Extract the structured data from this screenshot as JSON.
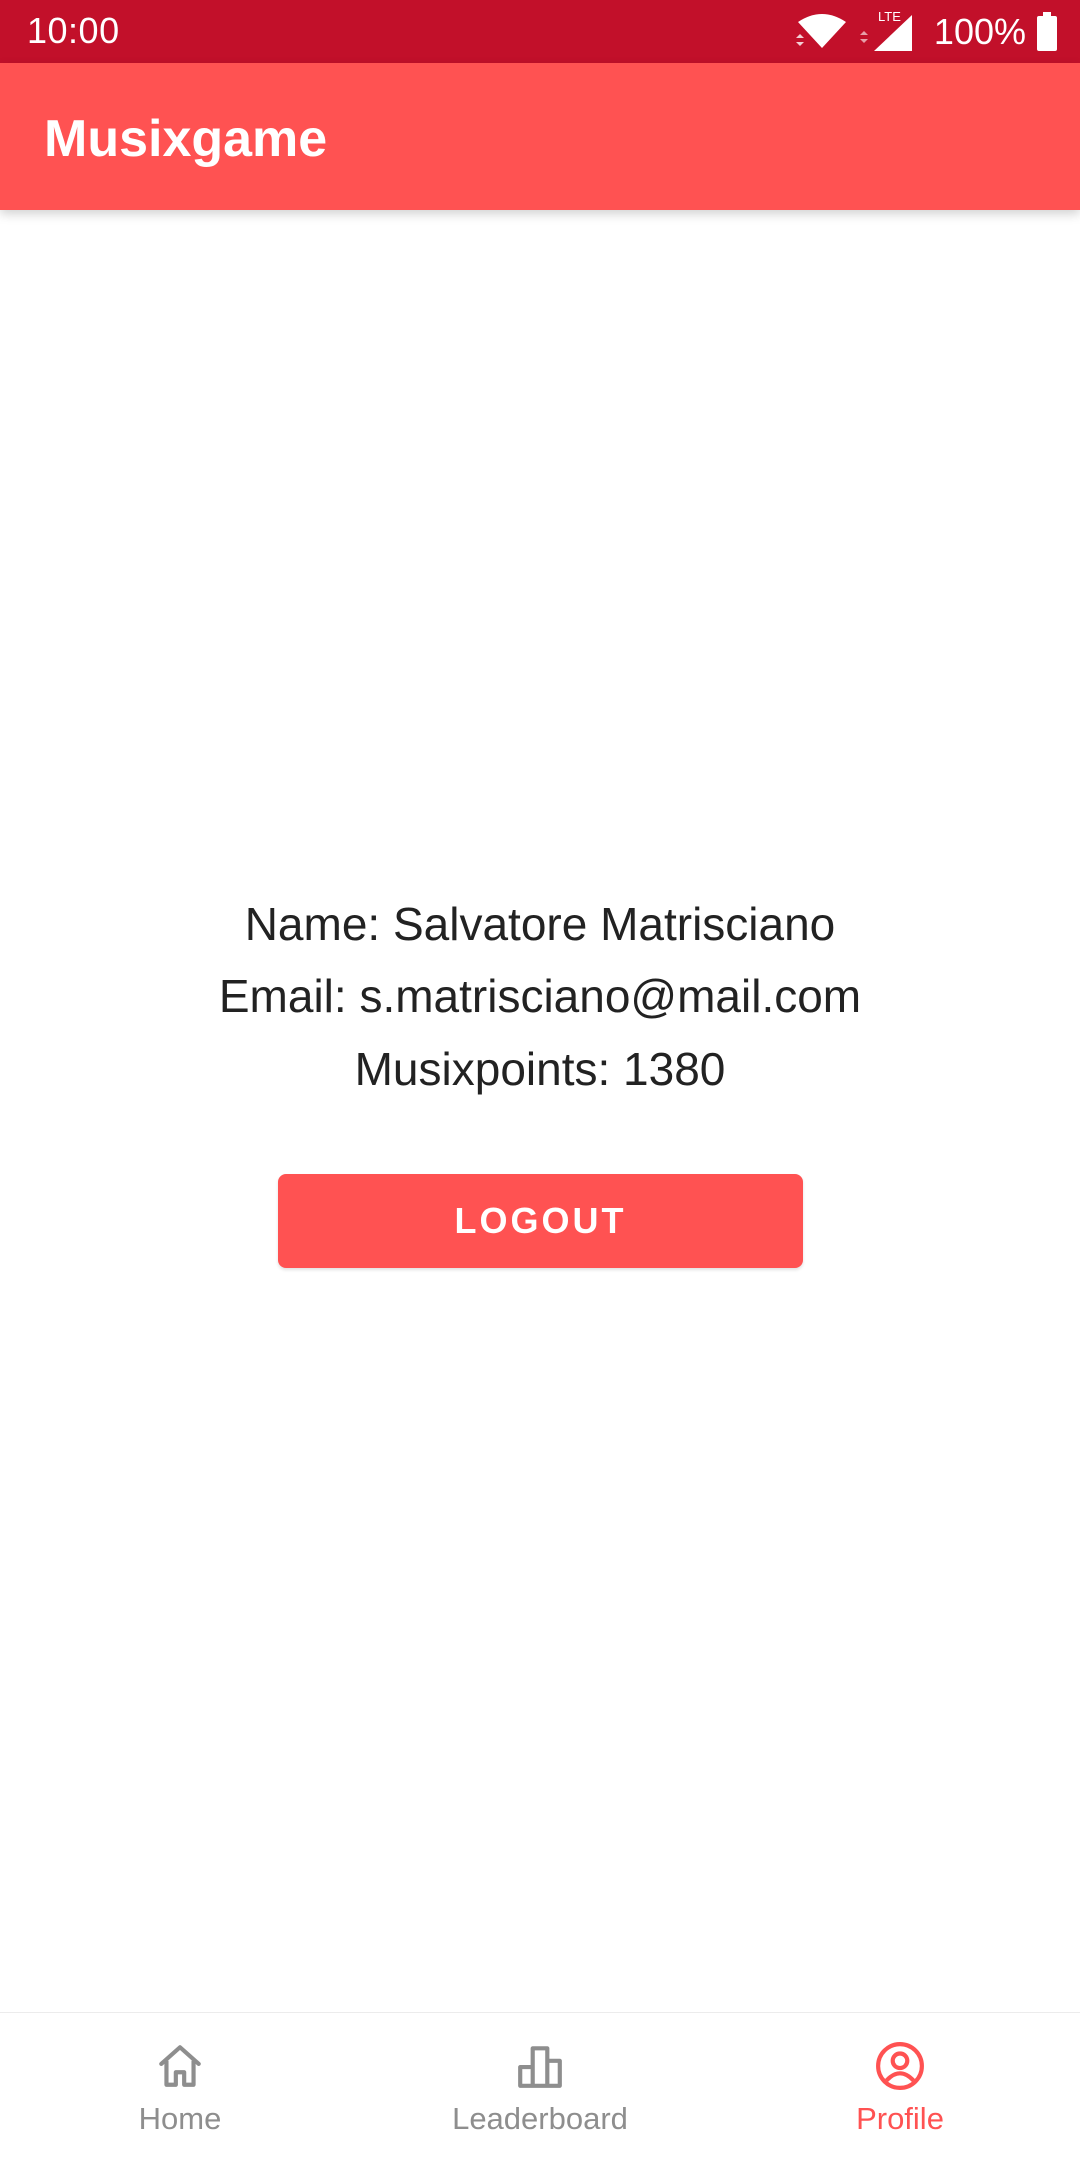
{
  "status_bar": {
    "time": "10:00",
    "network": "LTE",
    "battery": "100%",
    "color": "#c2102a"
  },
  "app_bar": {
    "title": "Musixgame",
    "color": "#ff5252"
  },
  "profile": {
    "name_line": "Name: Salvatore Matrisciano",
    "email_line": "Email: s.matrisciano@mail.com",
    "points_line": "Musixpoints: 1380"
  },
  "actions": {
    "logout_label": "LOGOUT"
  },
  "bottom_nav": {
    "items": [
      {
        "label": "Home",
        "icon": "home-icon",
        "active": false
      },
      {
        "label": "Leaderboard",
        "icon": "leaderboard-icon",
        "active": false
      },
      {
        "label": "Profile",
        "icon": "profile-icon",
        "active": true
      }
    ],
    "active_color": "#ff5252",
    "inactive_color": "#8e8e8e"
  }
}
